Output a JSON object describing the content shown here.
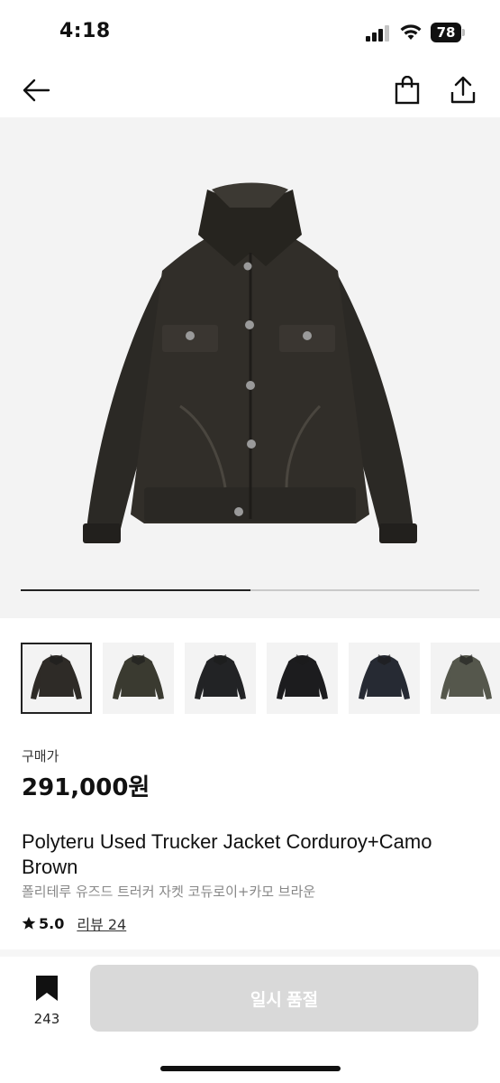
{
  "status_bar": {
    "time": "4:18",
    "battery": "78"
  },
  "nav": {
    "back_icon": "arrow-left-icon",
    "bag_icon": "shopping-bag-icon",
    "share_icon": "share-icon"
  },
  "gallery": {
    "progress_fraction": 0.5,
    "thumbnails": [
      {
        "tone": "#2e2b27",
        "selected": true
      },
      {
        "tone": "#3a3a30",
        "selected": false
      },
      {
        "tone": "#222325",
        "selected": false
      },
      {
        "tone": "#1c1c1e",
        "selected": false
      },
      {
        "tone": "#262a33",
        "selected": false
      },
      {
        "tone": "#55574c",
        "selected": false
      }
    ]
  },
  "product": {
    "price_label": "구매가",
    "price": "291,000원",
    "title_en": "Polyteru Used Trucker Jacket Corduroy+Camo Brown",
    "title_ko": "폴리테루 유즈드 트러커 자켓 코듀로이+카모 브라운",
    "rating": "5.0",
    "reviews": "리뷰 24"
  },
  "bottom_bar": {
    "bookmark_count": "243",
    "action_label": "일시 품절"
  },
  "colors": {
    "accent": "#111111",
    "disabled_button": "#d9d9d9"
  }
}
